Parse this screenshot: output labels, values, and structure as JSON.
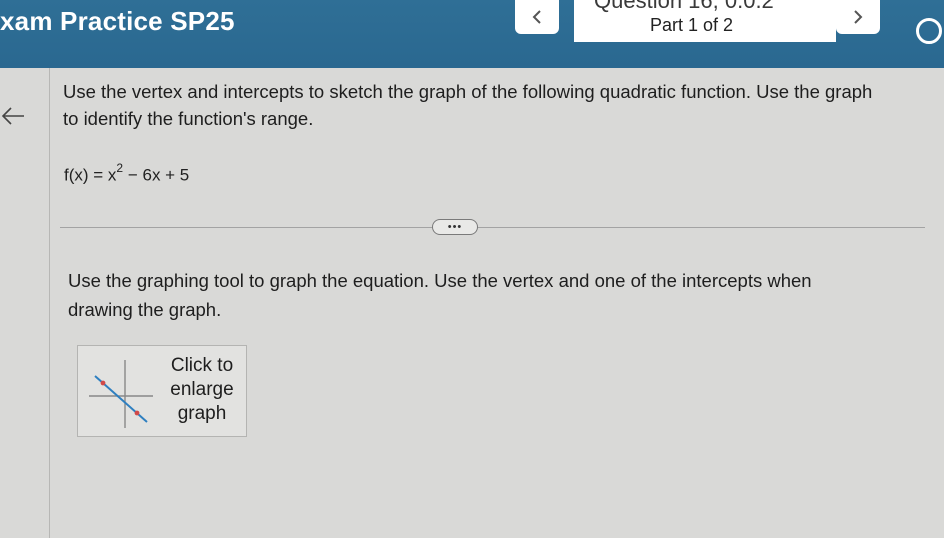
{
  "header": {
    "app_title": "xam Practice SP25",
    "question_label": "Question 16, 0.0.2",
    "part_label": "Part 1 of 2",
    "prev_symbol": "<",
    "next_symbol": ">"
  },
  "question": {
    "instructions": "Use the vertex and intercepts to sketch the graph of the following quadratic function. Use the graph to identify the function's range.",
    "function_lhs": "f(x)  =  x",
    "function_exponent": "2",
    "function_rhs": " − 6x + 5",
    "more_label": "•••",
    "tool_instructions": "Use the graphing tool to graph the equation. Use the vertex and one of the intercepts when drawing the graph.",
    "enlarge_label": "Click to enlarge graph"
  },
  "colors": {
    "header_bg": "#2f6f96",
    "page_bg": "#d9d9d7",
    "thumb_line": "#2e7fc0",
    "thumb_point": "#d04a4a"
  },
  "icons": {
    "back": "arrow-left-icon",
    "prev": "chevron-left-icon",
    "next": "chevron-right-icon",
    "status": "circle-icon",
    "graph": "graph-thumbnail-icon"
  }
}
